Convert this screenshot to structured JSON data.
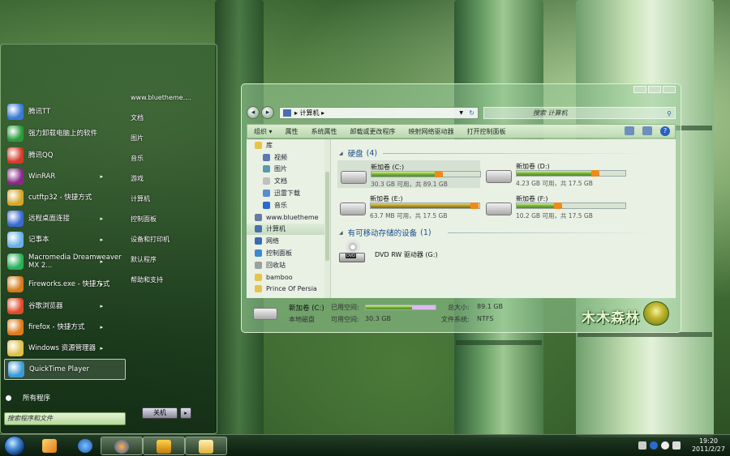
{
  "start_menu": {
    "programs": [
      {
        "label": "腾讯TT",
        "color": "#3a7ad6",
        "arrow": false
      },
      {
        "label": "强力卸载电脑上的软件",
        "color": "#2a9a3a",
        "arrow": false,
        "two_line": true
      },
      {
        "label": "腾讯QQ",
        "color": "#d63a2a",
        "arrow": false
      },
      {
        "label": "WinRAR",
        "color": "#8a2a8a",
        "arrow": true
      },
      {
        "label": "cutftp32 - 快捷方式",
        "color": "#d6a62a",
        "arrow": false
      },
      {
        "label": "远程桌面连接",
        "color": "#3a6ad6",
        "arrow": true
      },
      {
        "label": "记事本",
        "color": "#6ab0e6",
        "arrow": true
      },
      {
        "label": "Macromedia Dreamweaver MX 2...",
        "color": "#2ab05a",
        "arrow": true,
        "two_line": true
      },
      {
        "label": "Fireworks.exe - 快捷方式",
        "color": "#d67a1a",
        "arrow": true,
        "two_line": true
      },
      {
        "label": "谷歌浏览器",
        "color": "#e04a2a",
        "arrow": true
      },
      {
        "label": "firefox - 快捷方式",
        "color": "#e07a1a",
        "arrow": true
      },
      {
        "label": "Windows 资源管理器",
        "color": "#e0c04a",
        "arrow": true
      },
      {
        "label": "QuickTime Player",
        "color": "#3a9ad6",
        "arrow": false,
        "selected": true
      }
    ],
    "all_programs": "所有程序",
    "search_placeholder": "搜索程序和文件",
    "right_items": [
      "www.bluetheme....",
      "文档",
      "图片",
      "音乐",
      "游戏",
      "计算机",
      "控制面板",
      "设备和打印机",
      "默认程序",
      "帮助和支持"
    ],
    "shutdown": "关机",
    "shutdown_arrow": "▸"
  },
  "explorer": {
    "breadcrumb": "计算机",
    "breadcrumb_sep": "▸",
    "search_placeholder": "搜索 计算机",
    "toolbar": [
      "组织 ▾",
      "属性",
      "系统属性",
      "卸载或更改程序",
      "映射网络驱动器",
      "打开控制面板"
    ],
    "nav_items": [
      {
        "label": "库",
        "color": "#e6c34a",
        "indent": 0
      },
      {
        "label": "视频",
        "color": "#5a7ab0",
        "indent": 1
      },
      {
        "label": "图片",
        "color": "#5a9ab0",
        "indent": 1
      },
      {
        "label": "文档",
        "color": "#c0c0c0",
        "indent": 1
      },
      {
        "label": "迅雷下载",
        "color": "#5a8ad0",
        "indent": 1
      },
      {
        "label": "音乐",
        "color": "#2a6ad0",
        "indent": 1
      },
      {
        "label": "www.bluetheme",
        "color": "#6a7aa0",
        "indent": 0
      },
      {
        "label": "计算机",
        "color": "#4a6fb0",
        "indent": 0,
        "selected": true
      },
      {
        "label": "网络",
        "color": "#3a6ab0",
        "indent": 0
      },
      {
        "label": "控制面板",
        "color": "#3a8ad0",
        "indent": 0
      },
      {
        "label": "回收站",
        "color": "#9aa0a0",
        "indent": 0
      },
      {
        "label": "bamboo",
        "color": "#e6c34a",
        "indent": 0
      },
      {
        "label": "Prince Of Persia",
        "color": "#e6c34a",
        "indent": 0
      }
    ],
    "hard_disks_title": "硬盘",
    "hard_disks_count": "(4)",
    "drives": [
      {
        "name": "新加卷 (C:)",
        "free": "30.3 GB 可用，共 89.1 GB",
        "used_fraction": 0.66,
        "full": false
      },
      {
        "name": "新加卷 (D:)",
        "free": "4.23 GB 可用，共 17.5 GB",
        "used_fraction": 0.76,
        "full": false
      },
      {
        "name": "新加卷 (E:)",
        "free": "63.7 MB 可用，共 17.5 GB",
        "used_fraction": 0.99,
        "full": true
      },
      {
        "name": "新加卷 (F:)",
        "free": "10.2 GB 可用，共 17.5 GB",
        "used_fraction": 0.42,
        "full": false
      }
    ],
    "removable_title": "有可移动存储的设备",
    "removable_count": "(1)",
    "dvd_name": "DVD RW 驱动器 (G:)",
    "dvd_badge": "DVD",
    "details": {
      "name": "新加卷 (C:)",
      "type": "本地磁盘",
      "used_label": "已用空间:",
      "free_label": "可用空间:",
      "free_value": "30.3 GB",
      "total_label": "总大小:",
      "total_value": "89.1 GB",
      "fs_label": "文件系统:",
      "fs_value": "NTFS",
      "used_fraction": 0.66
    },
    "theme_logo": "木木森林"
  },
  "taskbar": {
    "clock_time": "19:20",
    "clock_date": "2011/2/27"
  },
  "colors": {
    "accent": "#1c4d8c",
    "drive_bar": "#77b13a",
    "drive_bar_full": "#b69a2a"
  }
}
